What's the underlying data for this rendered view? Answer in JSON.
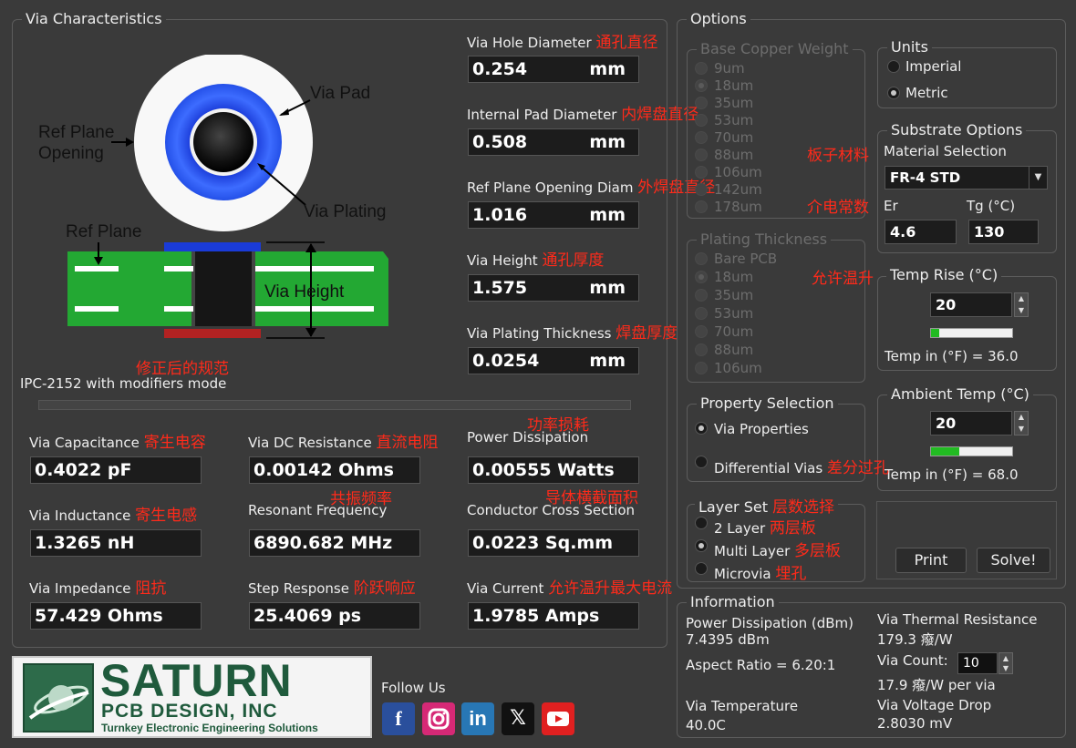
{
  "via_characteristics": {
    "title": "Via Characteristics",
    "diagram": {
      "via_pad": "Via Pad",
      "ref_plane_opening_1": "Ref Plane",
      "ref_plane_opening_2": "Opening",
      "via_plating": "Via Plating",
      "ref_plane": "Ref Plane",
      "via_height": "Via Height"
    },
    "mode_cn": "修正后的规范",
    "mode": "IPC-2152 with modifiers mode",
    "inputs": {
      "hole_diameter": {
        "label": "Via Hole Diameter",
        "cn": "通孔直径",
        "value": "0.254",
        "unit": "mm"
      },
      "internal_pad": {
        "label": "Internal Pad Diameter",
        "cn": "内焊盘直径",
        "value": "0.508",
        "unit": "mm"
      },
      "ref_plane_opening": {
        "label": "Ref Plane Opening Diam",
        "cn": "外焊盘直径",
        "value": "1.016",
        "unit": "mm"
      },
      "via_height": {
        "label": "Via Height",
        "cn": "通孔厚度",
        "value": "1.575",
        "unit": "mm"
      },
      "plating_thickness": {
        "label": "Via Plating Thickness",
        "cn": "焊盘厚度",
        "value": "0.0254",
        "unit": "mm"
      }
    },
    "results": {
      "capacitance": {
        "label": "Via Capacitance",
        "cn": "寄生电容",
        "value": "0.4022 pF"
      },
      "dc_resistance": {
        "label": "Via DC Resistance",
        "cn": "直流电阻",
        "value": "0.00142 Ohms"
      },
      "power_dissipation": {
        "label": "Power Dissipation",
        "cn": "功率损耗",
        "value": "0.00555 Watts"
      },
      "inductance": {
        "label": "Via Inductance",
        "cn": "寄生电感",
        "value": "1.3265 nH"
      },
      "resonant_frequency": {
        "label": "Resonant Frequency",
        "cn": "共振频率",
        "value": "6890.682 MHz"
      },
      "cross_section": {
        "label": "Conductor Cross Section",
        "cn": "导体横截面积",
        "value": "0.0223 Sq.mm"
      },
      "impedance": {
        "label": "Via Impedance",
        "cn": "阻抗",
        "value": "57.429 Ohms"
      },
      "step_response": {
        "label": "Step Response",
        "cn": "阶跃响应",
        "value": "25.4069 ps"
      },
      "via_current": {
        "label": "Via Current",
        "cn": "允许温升最大电流",
        "value": "1.9785 Amps"
      }
    }
  },
  "options": {
    "title": "Options",
    "base_copper": {
      "title": "Base Copper Weight",
      "items": [
        "9um",
        "18um",
        "35um",
        "53um",
        "70um",
        "88um",
        "106um",
        "142um",
        "178um"
      ],
      "selected": 1
    },
    "plating_thickness": {
      "title": "Plating Thickness",
      "items": [
        "Bare PCB",
        "18um",
        "35um",
        "53um",
        "70um",
        "88um",
        "106um"
      ],
      "selected": 1
    },
    "units": {
      "title": "Units",
      "imperial": "Imperial",
      "metric": "Metric",
      "selected": "Metric"
    },
    "substrate": {
      "title": "Substrate Options",
      "cn_material": "板子材料",
      "material_label": "Material Selection",
      "material_value": "FR-4 STD",
      "cn_er": "介电常数",
      "er_label": "Er",
      "er_value": "4.6",
      "tg_label": "Tg (°C)",
      "tg_value": "130"
    },
    "temp_rise": {
      "cn": "允许温升",
      "title": "Temp Rise (°C)",
      "value": "20",
      "level": 0.1,
      "fahrenheit": "Temp in (°F) = 36.0"
    },
    "ambient_temp": {
      "title": "Ambient Temp (°C)",
      "value": "20",
      "level": 0.35,
      "fahrenheit": "Temp in (°F) = 68.0"
    },
    "property_selection": {
      "title": "Property Selection",
      "via_properties": "Via Properties",
      "differential": "Differential Vias",
      "differential_cn": "差分过孔",
      "selected": "Via Properties"
    },
    "layer_set": {
      "title": "Layer Set",
      "title_cn": "层数选择",
      "two_layer": "2 Layer",
      "two_layer_cn": "两层板",
      "multi_layer": "Multi Layer",
      "multi_layer_cn": "多层板",
      "microvia": "Microvia",
      "microvia_cn": "埋孔",
      "selected": "Multi Layer"
    },
    "print_label": "Print",
    "solve_label": "Solve!"
  },
  "information": {
    "title": "Information",
    "power_dbm_label": "Power Dissipation (dBm)",
    "power_dbm_value": "7.4395 dBm",
    "aspect_ratio": "Aspect Ratio = 6.20:1",
    "via_temperature_label": "Via Temperature",
    "via_temperature_value": "40.0C",
    "thermal_resistance_label": "Via Thermal Resistance",
    "thermal_resistance_value": "179.3 癈/W",
    "via_count_label": "Via Count:",
    "via_count_value": "10",
    "per_via_value": "17.9 癈/W per via",
    "voltage_drop_label": "Via Voltage Drop",
    "voltage_drop_value": "2.8030 mV"
  },
  "branding": {
    "logo_main": "SATURN",
    "logo_sub": "PCB DESIGN, INC",
    "logo_tagline": "Turnkey Electronic Engineering Solutions",
    "follow_us": "Follow Us",
    "social_icons": [
      "facebook-icon",
      "instagram-icon",
      "linkedin-icon",
      "x-icon",
      "youtube-icon"
    ]
  }
}
